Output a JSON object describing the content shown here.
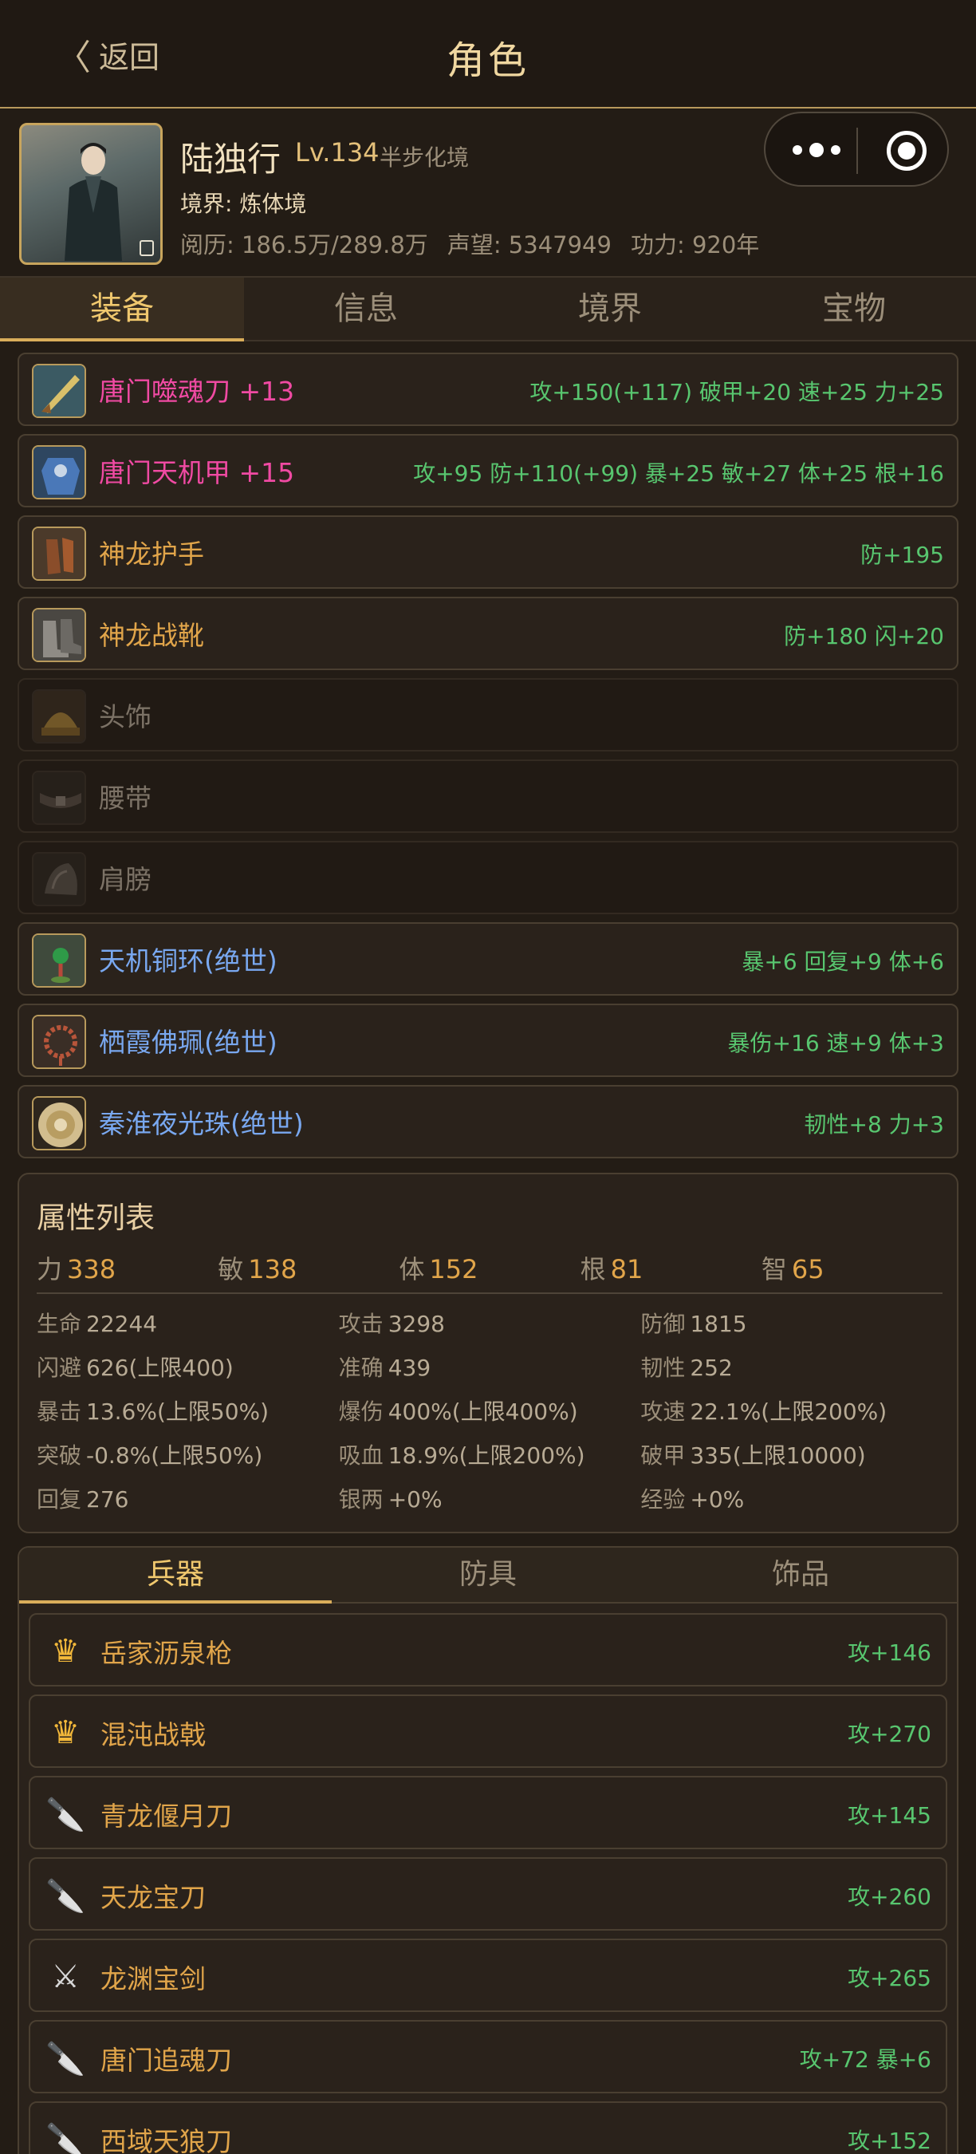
{
  "header": {
    "back_label": "返回",
    "title": "角色"
  },
  "profile": {
    "name": "陆独行",
    "level": "Lv.134",
    "realm_tag": "半步化境",
    "realm_line": "境界: 炼体境",
    "stats": [
      "阅历: 186.5万/289.8万",
      "声望: 5347949",
      "功力: 920年"
    ]
  },
  "tabs": [
    "装备",
    "信息",
    "境界",
    "宝物"
  ],
  "equipment": [
    {
      "name": "唐门噬魂刀 +13",
      "stat": "攻+150(+117) 破甲+20 速+25 力+25",
      "quality": "pink",
      "icon": "blade-icon"
    },
    {
      "name": "唐门天机甲 +15",
      "stat": "攻+95 防+110(+99) 暴+25 敏+27 体+25 根+16",
      "quality": "pink",
      "icon": "armor-icon"
    },
    {
      "name": "神龙护手",
      "stat": "防+195",
      "quality": "gold",
      "icon": "gauntlet-icon"
    },
    {
      "name": "神龙战靴",
      "stat": "防+180 闪+20",
      "quality": "gold",
      "icon": "boots-icon"
    },
    {
      "name": "头饰",
      "stat": "",
      "quality": "empty",
      "icon": "helmet-icon"
    },
    {
      "name": "腰带",
      "stat": "",
      "quality": "empty",
      "icon": "belt-icon"
    },
    {
      "name": "肩膀",
      "stat": "",
      "quality": "empty",
      "icon": "shoulder-icon"
    },
    {
      "name": "天机铜环(绝世)",
      "stat": "暴+6 回复+9 体+6",
      "quality": "blue",
      "icon": "ring-icon"
    },
    {
      "name": "栖霞佛珮(绝世)",
      "stat": "暴伤+16 速+9 体+3",
      "quality": "blue",
      "icon": "beads-icon"
    },
    {
      "name": "秦淮夜光珠(绝世)",
      "stat": "韧性+8 力+3",
      "quality": "blue",
      "icon": "pearl-icon"
    }
  ],
  "attributes": {
    "title": "属性列表",
    "basic": [
      {
        "k": "力",
        "v": "338"
      },
      {
        "k": "敏",
        "v": "138"
      },
      {
        "k": "体",
        "v": "152"
      },
      {
        "k": "根",
        "v": "81"
      },
      {
        "k": "智",
        "v": "65"
      }
    ],
    "grid": [
      [
        {
          "k": "生命",
          "v": "22244"
        },
        {
          "k": "攻击",
          "v": "3298"
        },
        {
          "k": "防御",
          "v": "1815"
        }
      ],
      [
        {
          "k": "闪避",
          "v": "626(上限400)"
        },
        {
          "k": "准确",
          "v": "439"
        },
        {
          "k": "韧性",
          "v": "252"
        }
      ],
      [
        {
          "k": "暴击",
          "v": "13.6%(上限50%)"
        },
        {
          "k": "爆伤",
          "v": "400%(上限400%)"
        },
        {
          "k": "攻速",
          "v": "22.1%(上限200%)"
        }
      ],
      [
        {
          "k": "突破",
          "v": "-0.8%(上限50%)"
        },
        {
          "k": "吸血",
          "v": "18.9%(上限200%)"
        },
        {
          "k": "破甲",
          "v": "335(上限10000)"
        }
      ],
      [
        {
          "k": "回复",
          "v": "276"
        },
        {
          "k": "银两",
          "v": "+0%"
        },
        {
          "k": "经验",
          "v": "+0%"
        }
      ]
    ]
  },
  "inventory": {
    "tabs": [
      "兵器",
      "防具",
      "饰品"
    ],
    "items": [
      {
        "name": "岳家沥泉枪",
        "stat": "攻+146",
        "icon": "crown-icon",
        "glyph": "♛"
      },
      {
        "name": "混沌战戟",
        "stat": "攻+270",
        "icon": "crown-icon",
        "glyph": "♛"
      },
      {
        "name": "青龙偃月刀",
        "stat": "攻+145",
        "icon": "knife-icon",
        "glyph": "🔪"
      },
      {
        "name": "天龙宝刀",
        "stat": "攻+260",
        "icon": "knife-icon",
        "glyph": "🔪"
      },
      {
        "name": "龙渊宝剑",
        "stat": "攻+265",
        "icon": "crossed-swords-icon",
        "glyph": "⚔"
      },
      {
        "name": "唐门追魂刀",
        "stat": "攻+72 暴+6",
        "icon": "knife-icon",
        "glyph": "🔪"
      },
      {
        "name": "西域天狼刀",
        "stat": "攻+152",
        "icon": "knife-icon",
        "glyph": "🔪"
      }
    ]
  }
}
